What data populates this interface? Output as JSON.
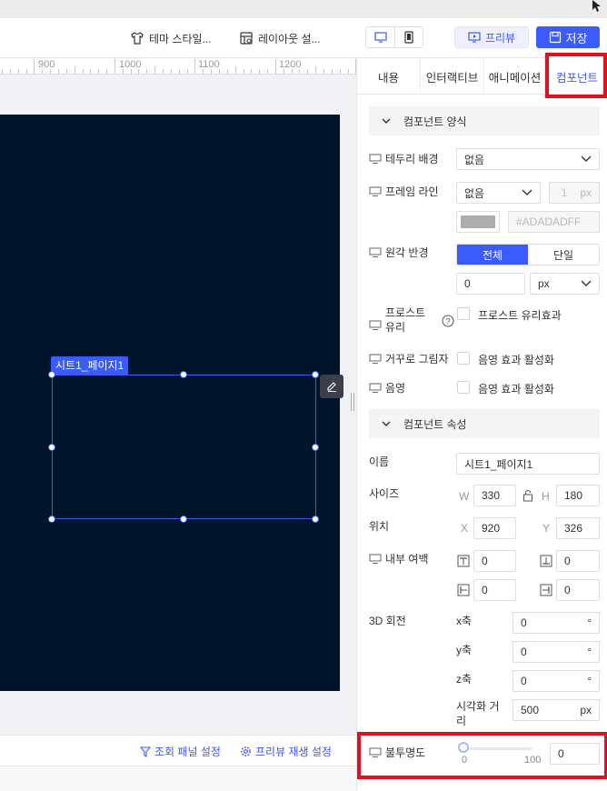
{
  "toolbar": {
    "theme_style": "테마 스타일...",
    "layout_settings": "레이아웃 설...",
    "preview": "프리뷰",
    "save": "저장"
  },
  "ruler": {
    "labels": [
      "900",
      "1000",
      "1100",
      "1200"
    ]
  },
  "canvas": {
    "selection_label": "시트1_페이지1"
  },
  "bottom_bar": {
    "query_panel_settings": "조회 패널 설정",
    "preview_play_settings": "프리뷰 재생 설정"
  },
  "tabs": [
    {
      "label": "내용"
    },
    {
      "label": "인터랙티브"
    },
    {
      "label": "애니메이션"
    },
    {
      "label": "컴포넌트"
    }
  ],
  "component_style": {
    "header": "컴포넌트 양식",
    "border_bg_label": "테두리 배경",
    "border_bg_value": "없음",
    "frame_line_label": "프레임 라인",
    "frame_line_value": "없음",
    "frame_width": "1",
    "frame_unit": "px",
    "frame_color_hex": "#ADADADFF",
    "corner_label": "원각 반경",
    "corner_all": "전체",
    "corner_single": "단일",
    "corner_value": "0",
    "corner_unit": "px",
    "frost_label_1": "프로스트",
    "frost_label_2": "유리",
    "frost_checkbox": "프로스트 유리효과",
    "reflection_label": "거꾸로 그림자",
    "reflection_checkbox": "음영 효과 활성화",
    "shadow_label": "음영",
    "shadow_checkbox": "음영 효과 활성화"
  },
  "component_props": {
    "header": "컴포넌트 속성",
    "name_label": "이름",
    "name_value": "시트1_페이지1",
    "size_label": "사이즈",
    "w_label": "W",
    "w_value": "330",
    "h_label": "H",
    "h_value": "180",
    "pos_label": "위치",
    "x_label": "X",
    "x_value": "920",
    "y_label": "Y",
    "y_value": "326",
    "padding_label": "내부 여백",
    "pad_top": "0",
    "pad_bottom": "0",
    "pad_left": "0",
    "pad_right": "0",
    "rotate_label": "3D 회전",
    "rx_label": "x축",
    "rx_value": "0",
    "ry_label": "y축",
    "ry_value": "0",
    "rz_label": "z축",
    "rz_value": "0",
    "deg": "°",
    "view_dist_label_1": "시각화 거",
    "view_dist_label_2": "리",
    "view_dist_value": "500",
    "view_dist_unit": "px",
    "opacity_label": "불투명도",
    "opacity_min": "0",
    "opacity_max": "100",
    "opacity_value": "0"
  },
  "colors": {
    "accent": "#3b5bfd",
    "canvas_bg": "#00142b",
    "highlight": "#e0101c",
    "swatch": "#ADADAD"
  }
}
